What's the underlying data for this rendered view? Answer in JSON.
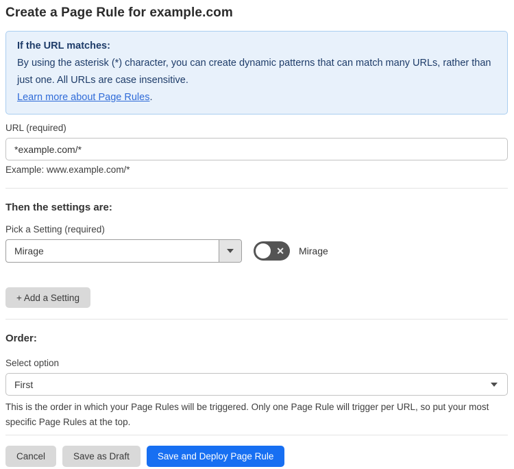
{
  "page": {
    "title": "Create a Page Rule for example.com"
  },
  "info_box": {
    "heading": "If the URL matches:",
    "body": "By using the asterisk (*) character, you can create dynamic patterns that can match many URLs, rather than just one. All URLs are case insensitive.",
    "link_label": "Learn more about Page Rules",
    "link_suffix": "."
  },
  "url_field": {
    "label": "URL (required)",
    "value": "*example.com/*",
    "helper": "Example: www.example.com/*"
  },
  "settings_section": {
    "heading": "Then the settings are:",
    "setting_label": "Pick a Setting (required)",
    "setting_value": "Mirage",
    "toggle_state": "off",
    "toggle_icon": "✕",
    "toggle_label": "Mirage",
    "add_setting_label": "+ Add a Setting"
  },
  "order_section": {
    "heading": "Order:",
    "select_label": "Select option",
    "select_value": "First",
    "helper": "This is the order in which your Page Rules will be triggered. Only one Page Rule will trigger per URL, so put your most specific Page Rules at the top."
  },
  "actions": {
    "cancel_label": "Cancel",
    "save_draft_label": "Save as Draft",
    "save_deploy_label": "Save and Deploy Page Rule"
  },
  "colors": {
    "info_background": "#e8f1fb",
    "info_border": "#a9cdf0",
    "info_text": "#1e3c69",
    "link": "#2f6bd8",
    "primary_button": "#176ff2",
    "gray_button": "#d9d9d9",
    "toggle_off": "#545454",
    "divider": "#e3e3e3"
  }
}
